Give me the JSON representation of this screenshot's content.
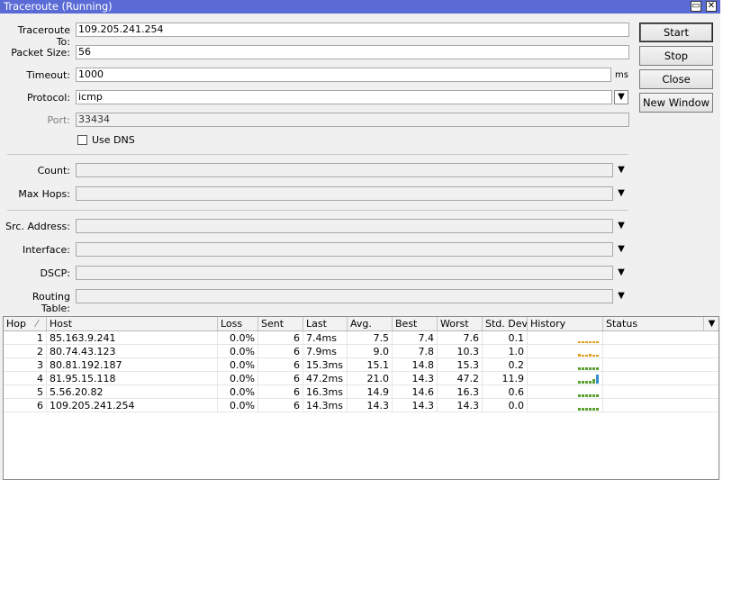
{
  "window": {
    "title": "Traceroute (Running)",
    "restore_glyph": "▭",
    "close_glyph": "✕"
  },
  "form": {
    "traceroute_to": {
      "label": "Traceroute To:",
      "value": "109.205.241.254"
    },
    "packet_size": {
      "label": "Packet Size:",
      "value": "56"
    },
    "timeout": {
      "label": "Timeout:",
      "value": "1000",
      "unit": "ms"
    },
    "protocol": {
      "label": "Protocol:",
      "value": "icmp"
    },
    "port": {
      "label": "Port:",
      "value": "33434"
    },
    "use_dns": {
      "label": "Use DNS",
      "checked": false
    },
    "count": {
      "label": "Count:",
      "value": ""
    },
    "max_hops": {
      "label": "Max Hops:",
      "value": ""
    },
    "src_address": {
      "label": "Src. Address:",
      "value": ""
    },
    "interface": {
      "label": "Interface:",
      "value": ""
    },
    "dscp": {
      "label": "DSCP:",
      "value": ""
    },
    "routing_table": {
      "label": "Routing Table:",
      "value": ""
    }
  },
  "buttons": {
    "start": "Start",
    "stop": "Stop",
    "close": "Close",
    "new_window": "New Window"
  },
  "table": {
    "columns": [
      "Hop",
      "Host",
      "Loss",
      "Sent",
      "Last",
      "Avg.",
      "Best",
      "Worst",
      "Std. Dev.",
      "History",
      "Status"
    ],
    "sort_indicator": "⁄",
    "rows": [
      {
        "hop": "1",
        "host": "85.163.9.241",
        "loss": "0.0%",
        "sent": "6",
        "last": "7.4ms",
        "avg": "7.5",
        "best": "7.4",
        "worst": "7.6",
        "std_dev": "0.1",
        "status": "",
        "history": {
          "color": "#e0a020",
          "levels": [
            0.2,
            0.2,
            0.2,
            0.2,
            0.2,
            0.2
          ]
        }
      },
      {
        "hop": "2",
        "host": "80.74.43.123",
        "loss": "0.0%",
        "sent": "6",
        "last": "7.9ms",
        "avg": "9.0",
        "best": "7.8",
        "worst": "10.3",
        "std_dev": "1.0",
        "status": "",
        "history": {
          "color": "#e0a020",
          "levels": [
            0.3,
            0.2,
            0.2,
            0.3,
            0.2,
            0.2
          ]
        }
      },
      {
        "hop": "3",
        "host": "80.81.192.187",
        "loss": "0.0%",
        "sent": "6",
        "last": "15.3ms",
        "avg": "15.1",
        "best": "14.8",
        "worst": "15.3",
        "std_dev": "0.2",
        "status": "",
        "history": {
          "color": "#5aa030",
          "levels": [
            0.3,
            0.3,
            0.3,
            0.3,
            0.3,
            0.3
          ]
        }
      },
      {
        "hop": "4",
        "host": "81.95.15.118",
        "loss": "0.0%",
        "sent": "6",
        "last": "47.2ms",
        "avg": "21.0",
        "best": "14.3",
        "worst": "47.2",
        "std_dev": "11.9",
        "status": "",
        "history": {
          "color": "#5aa030",
          "levels": [
            0.3,
            0.3,
            0.3,
            0.3,
            0.5,
            1.0
          ]
        }
      },
      {
        "hop": "5",
        "host": "5.56.20.82",
        "loss": "0.0%",
        "sent": "6",
        "last": "16.3ms",
        "avg": "14.9",
        "best": "14.6",
        "worst": "16.3",
        "std_dev": "0.6",
        "status": "",
        "history": {
          "color": "#5aa030",
          "levels": [
            0.3,
            0.3,
            0.3,
            0.3,
            0.3,
            0.3
          ]
        }
      },
      {
        "hop": "6",
        "host": "109.205.241.254",
        "loss": "0.0%",
        "sent": "6",
        "last": "14.3ms",
        "avg": "14.3",
        "best": "14.3",
        "worst": "14.3",
        "std_dev": "0.0",
        "status": "",
        "history": {
          "color": "#5aa030",
          "levels": [
            0.3,
            0.3,
            0.3,
            0.3,
            0.3,
            0.3
          ]
        }
      }
    ]
  }
}
